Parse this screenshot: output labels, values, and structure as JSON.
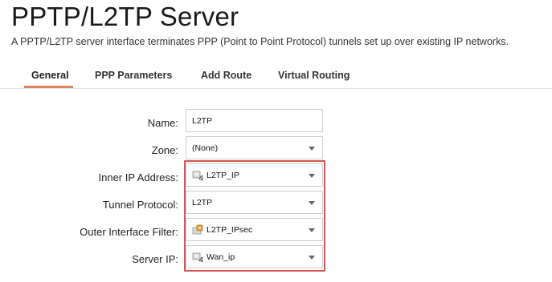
{
  "page": {
    "title": "PPTP/L2TP Server",
    "description": "A PPTP/L2TP server interface terminates PPP (Point to Point Protocol) tunnels set up over existing IP networks."
  },
  "tabs": [
    {
      "label": "General",
      "active": true
    },
    {
      "label": "PPP Parameters",
      "active": false
    },
    {
      "label": "Add Route",
      "active": false
    },
    {
      "label": "Virtual Routing",
      "active": false
    }
  ],
  "form": {
    "name": {
      "label": "Name:",
      "value": "L2TP"
    },
    "zone": {
      "label": "Zone:",
      "value": "(None)"
    },
    "inner_ip": {
      "label": "Inner IP Address:",
      "value": "L2TP_IP",
      "icon": "ip-address-object-icon"
    },
    "tunnel_protocol": {
      "label": "Tunnel Protocol:",
      "value": "L2TP"
    },
    "outer_interface_filter": {
      "label": "Outer Interface Filter:",
      "value": "L2TP_IPsec",
      "icon": "ipsec-interface-icon"
    },
    "server_ip": {
      "label": "Server IP:",
      "value": "Wan_ip",
      "icon": "ip-address-object-icon"
    }
  },
  "colors": {
    "accent_underline": "#e0825a",
    "highlight_border": "#d9534f"
  }
}
